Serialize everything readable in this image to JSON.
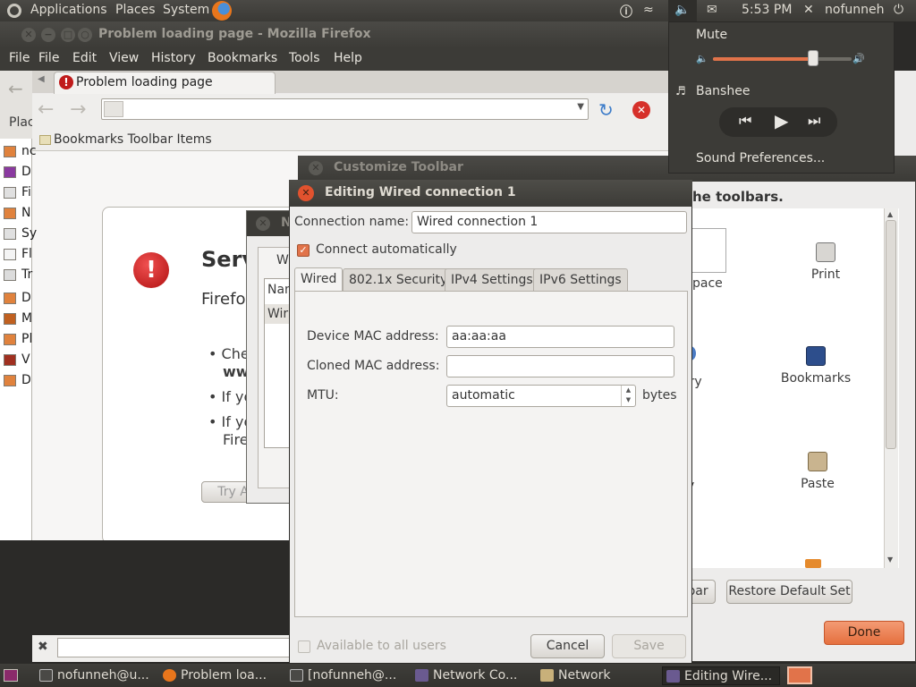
{
  "top_panel": {
    "menus": [
      "Applications",
      "Places",
      "System"
    ],
    "clock": "5:53 PM",
    "user": "nofunneh"
  },
  "sound_menu": {
    "mute_label": "Mute",
    "volume_level": 0.72,
    "player_name": "Banshee",
    "preferences_label": "Sound Preferences..."
  },
  "firefox": {
    "window_title": "Problem loading page - Mozilla Firefox",
    "menus": [
      "File",
      "Edit",
      "View",
      "History",
      "Bookmarks",
      "Tools",
      "Help"
    ],
    "tab_title": "Problem loading page",
    "bookmarks_item": "Bookmarks Toolbar Items",
    "left_label": "Plac",
    "sidebar_items": [
      "nc",
      "D",
      "Fi",
      "N",
      "Sy",
      "Fl",
      "Tr",
      "D",
      "M",
      "Pl",
      "V",
      "D"
    ],
    "error_title": "Serv",
    "error_sub": "Firefo",
    "bullets": [
      "Che",
      "www",
      "If yo",
      "If yo",
      "Fire"
    ],
    "try_again": "Try Ag"
  },
  "back_dialog": {
    "title": "N",
    "tab": "W",
    "col_header": "Nam",
    "row": "Wir"
  },
  "customize_toolbar": {
    "title": "Customize Toolbar",
    "heading_partial": "he toolbars.",
    "items": [
      {
        "label": "Print",
        "icon": "printer-icon"
      },
      {
        "label": "Bookmarks",
        "icon": "bookmarks-icon"
      },
      {
        "label": "Paste",
        "icon": "paste-icon"
      }
    ],
    "partial_labels": [
      "pace",
      "ory",
      "y"
    ],
    "toolbar_btn_partial": "bar",
    "restore_button": "Restore Default Set",
    "done_button": "Done"
  },
  "edit_connection": {
    "title": "Editing Wired connection 1",
    "name_label": "Connection name:",
    "name_value": "Wired connection 1",
    "auto_connect_label": "Connect automatically",
    "tabs": [
      "Wired",
      "802.1x Security",
      "IPv4 Settings",
      "IPv6 Settings"
    ],
    "device_mac_label": "Device MAC address:",
    "device_mac_value": "aa:aa:aa",
    "cloned_mac_label": "Cloned MAC address:",
    "cloned_mac_value": "",
    "mtu_label": "MTU:",
    "mtu_value": "automatic",
    "mtu_unit": "bytes",
    "all_users_label": "Available to all users",
    "cancel_button": "Cancel",
    "save_button": "Save"
  },
  "taskbar": [
    {
      "label": "nofunneh@u...",
      "icon": "terminal-icon"
    },
    {
      "label": "Problem loa...",
      "icon": "firefox-icon"
    },
    {
      "label": "[nofunneh@...",
      "icon": "terminal-icon"
    },
    {
      "label": "Network Co...",
      "icon": "network-icon"
    },
    {
      "label": "Network",
      "icon": "folder-icon"
    },
    {
      "label": "Editing Wire...",
      "icon": "network-icon"
    }
  ]
}
